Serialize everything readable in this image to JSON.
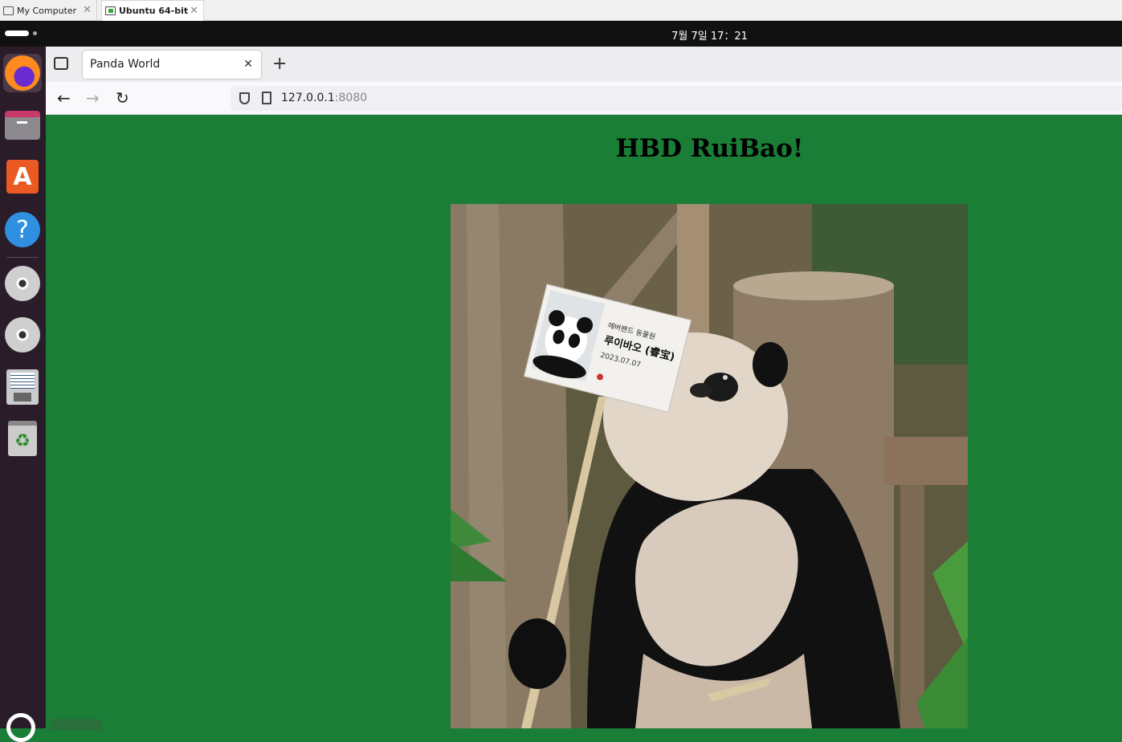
{
  "vm_tabs": [
    {
      "label": "My Computer"
    },
    {
      "label": "Ubuntu 64-bit"
    }
  ],
  "topbar": {
    "clock": "7월 7일  17：21"
  },
  "dock": {
    "items": [
      "firefox-icon",
      "files-icon",
      "app-store-icon",
      "help-icon",
      "dvd-icon",
      "dvd-icon",
      "floppy-icon",
      "trash-icon"
    ],
    "store_glyph": "A",
    "help_glyph": "?",
    "trash_glyph": "♻"
  },
  "browser": {
    "tab_title": "Panda World",
    "tab_close": "✕",
    "new_tab": "+",
    "back": "←",
    "forward": "→",
    "reload": "↻",
    "url_host": "127.0.0.1",
    "url_port": ":8080"
  },
  "page": {
    "heading": "HBD RuiBao!",
    "sign": {
      "line1": "에버랜드 동물원",
      "line2": "루이바오 (睿宝)",
      "date": "2023.07.07"
    }
  },
  "colors": {
    "page_background": "#1a7e37",
    "topbar": "#111111",
    "dock": "#2b1c2a"
  }
}
